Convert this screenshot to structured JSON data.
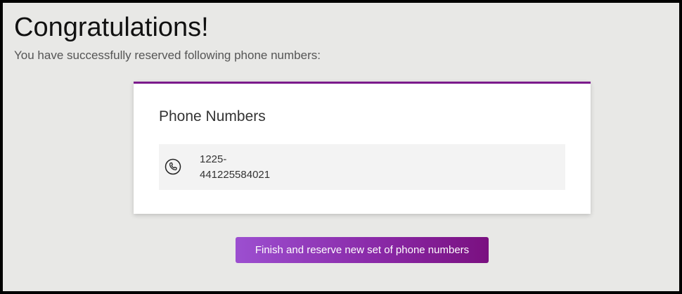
{
  "header": {
    "title": "Congratulations!",
    "subtitle": "You have successfully reserved following phone numbers:"
  },
  "card": {
    "accent_color": "#7b1a8c",
    "title": "Phone Numbers",
    "numbers": [
      {
        "icon": "phone-icon",
        "line1": "1225-",
        "line2": "441225584021"
      }
    ]
  },
  "actions": {
    "finish_label": "Finish and reserve new set of phone numbers",
    "finish_colors": [
      "#9c4fd0",
      "#7a1080"
    ]
  }
}
